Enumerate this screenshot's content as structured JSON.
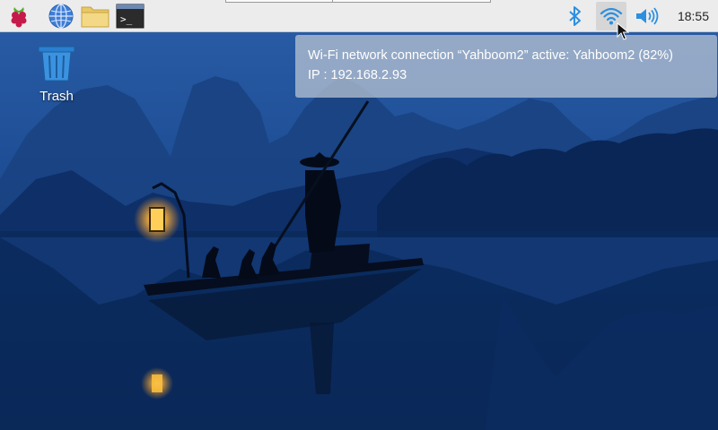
{
  "taskbar": {
    "launchers": [
      {
        "name": "raspberry-menu",
        "icon": "raspberry-icon"
      },
      {
        "name": "web-browser",
        "icon": "globe-icon"
      },
      {
        "name": "file-manager",
        "icon": "folder-icon"
      },
      {
        "name": "terminal",
        "icon": "terminal-icon",
        "glyph": ">_"
      }
    ],
    "tray": {
      "bluetooth_icon": "bluetooth-icon",
      "wifi_icon": "wifi-icon",
      "volume_icon": "speaker-icon",
      "clock": "18:55"
    }
  },
  "desktop": {
    "icons": [
      {
        "label": "Trash",
        "icon": "trash-icon"
      }
    ]
  },
  "tooltip": {
    "line1": "Wi-Fi network connection “Yahboom2” active: Yahboom2 (82%)",
    "line2": "IP : 192.168.2.93"
  },
  "colors": {
    "taskbar_bg": "#ececec",
    "accent_blue": "#2c8fe0",
    "wallpaper_sky": "#1f4f97",
    "wallpaper_water": "#0a2450"
  }
}
